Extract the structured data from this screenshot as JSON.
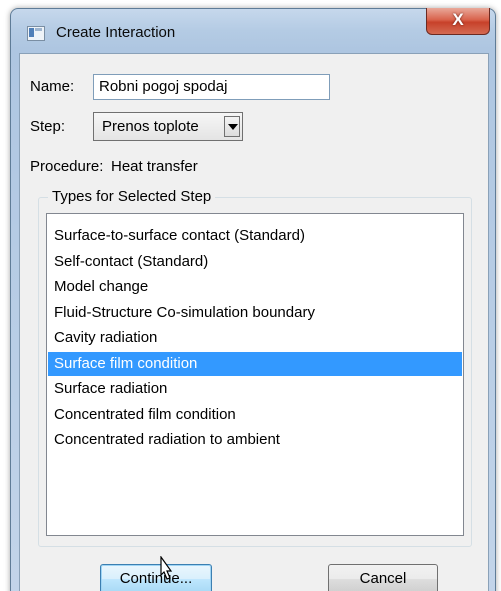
{
  "window": {
    "title": "Create Interaction",
    "close_glyph": "X"
  },
  "form": {
    "name_label": "Name:",
    "name_value": "Robni pogoj spodaj",
    "step_label": "Step:",
    "step_value": "Prenos toplote",
    "procedure_label": "Procedure:",
    "procedure_value": "Heat transfer"
  },
  "types": {
    "group_title": "Types for Selected Step",
    "selected_index": 5,
    "items": [
      "Surface-to-surface contact (Standard)",
      "Self-contact (Standard)",
      "Model change",
      "Fluid-Structure Co-simulation boundary",
      "Cavity radiation",
      "Surface film condition",
      "Surface radiation",
      "Concentrated film condition",
      "Concentrated radiation to ambient"
    ]
  },
  "buttons": {
    "continue_label": "Continue...",
    "cancel_label": "Cancel"
  },
  "colors": {
    "selection": "#3399ff",
    "close_button": "#c7412a"
  }
}
